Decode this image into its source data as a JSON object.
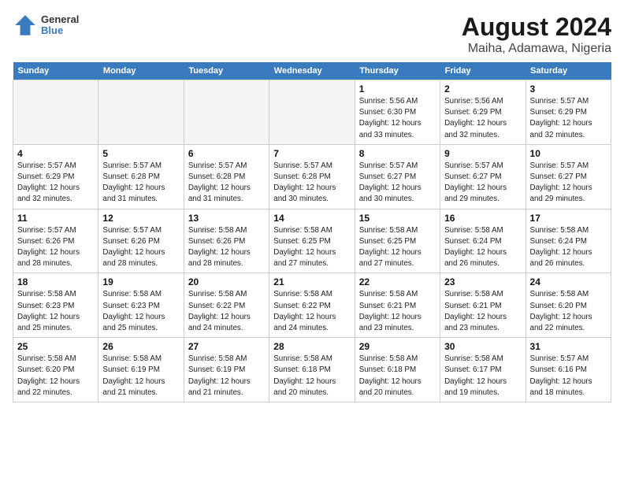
{
  "header": {
    "logo_line1": "General",
    "logo_line2": "Blue",
    "title": "August 2024",
    "subtitle": "Maiha, Adamawa, Nigeria"
  },
  "calendar": {
    "weekdays": [
      "Sunday",
      "Monday",
      "Tuesday",
      "Wednesday",
      "Thursday",
      "Friday",
      "Saturday"
    ],
    "weeks": [
      [
        {
          "day": "",
          "info": ""
        },
        {
          "day": "",
          "info": ""
        },
        {
          "day": "",
          "info": ""
        },
        {
          "day": "",
          "info": ""
        },
        {
          "day": "1",
          "info": "Sunrise: 5:56 AM\nSunset: 6:30 PM\nDaylight: 12 hours\nand 33 minutes."
        },
        {
          "day": "2",
          "info": "Sunrise: 5:56 AM\nSunset: 6:29 PM\nDaylight: 12 hours\nand 32 minutes."
        },
        {
          "day": "3",
          "info": "Sunrise: 5:57 AM\nSunset: 6:29 PM\nDaylight: 12 hours\nand 32 minutes."
        }
      ],
      [
        {
          "day": "4",
          "info": "Sunrise: 5:57 AM\nSunset: 6:29 PM\nDaylight: 12 hours\nand 32 minutes."
        },
        {
          "day": "5",
          "info": "Sunrise: 5:57 AM\nSunset: 6:28 PM\nDaylight: 12 hours\nand 31 minutes."
        },
        {
          "day": "6",
          "info": "Sunrise: 5:57 AM\nSunset: 6:28 PM\nDaylight: 12 hours\nand 31 minutes."
        },
        {
          "day": "7",
          "info": "Sunrise: 5:57 AM\nSunset: 6:28 PM\nDaylight: 12 hours\nand 30 minutes."
        },
        {
          "day": "8",
          "info": "Sunrise: 5:57 AM\nSunset: 6:27 PM\nDaylight: 12 hours\nand 30 minutes."
        },
        {
          "day": "9",
          "info": "Sunrise: 5:57 AM\nSunset: 6:27 PM\nDaylight: 12 hours\nand 29 minutes."
        },
        {
          "day": "10",
          "info": "Sunrise: 5:57 AM\nSunset: 6:27 PM\nDaylight: 12 hours\nand 29 minutes."
        }
      ],
      [
        {
          "day": "11",
          "info": "Sunrise: 5:57 AM\nSunset: 6:26 PM\nDaylight: 12 hours\nand 28 minutes."
        },
        {
          "day": "12",
          "info": "Sunrise: 5:57 AM\nSunset: 6:26 PM\nDaylight: 12 hours\nand 28 minutes."
        },
        {
          "day": "13",
          "info": "Sunrise: 5:58 AM\nSunset: 6:26 PM\nDaylight: 12 hours\nand 28 minutes."
        },
        {
          "day": "14",
          "info": "Sunrise: 5:58 AM\nSunset: 6:25 PM\nDaylight: 12 hours\nand 27 minutes."
        },
        {
          "day": "15",
          "info": "Sunrise: 5:58 AM\nSunset: 6:25 PM\nDaylight: 12 hours\nand 27 minutes."
        },
        {
          "day": "16",
          "info": "Sunrise: 5:58 AM\nSunset: 6:24 PM\nDaylight: 12 hours\nand 26 minutes."
        },
        {
          "day": "17",
          "info": "Sunrise: 5:58 AM\nSunset: 6:24 PM\nDaylight: 12 hours\nand 26 minutes."
        }
      ],
      [
        {
          "day": "18",
          "info": "Sunrise: 5:58 AM\nSunset: 6:23 PM\nDaylight: 12 hours\nand 25 minutes."
        },
        {
          "day": "19",
          "info": "Sunrise: 5:58 AM\nSunset: 6:23 PM\nDaylight: 12 hours\nand 25 minutes."
        },
        {
          "day": "20",
          "info": "Sunrise: 5:58 AM\nSunset: 6:22 PM\nDaylight: 12 hours\nand 24 minutes."
        },
        {
          "day": "21",
          "info": "Sunrise: 5:58 AM\nSunset: 6:22 PM\nDaylight: 12 hours\nand 24 minutes."
        },
        {
          "day": "22",
          "info": "Sunrise: 5:58 AM\nSunset: 6:21 PM\nDaylight: 12 hours\nand 23 minutes."
        },
        {
          "day": "23",
          "info": "Sunrise: 5:58 AM\nSunset: 6:21 PM\nDaylight: 12 hours\nand 23 minutes."
        },
        {
          "day": "24",
          "info": "Sunrise: 5:58 AM\nSunset: 6:20 PM\nDaylight: 12 hours\nand 22 minutes."
        }
      ],
      [
        {
          "day": "25",
          "info": "Sunrise: 5:58 AM\nSunset: 6:20 PM\nDaylight: 12 hours\nand 22 minutes."
        },
        {
          "day": "26",
          "info": "Sunrise: 5:58 AM\nSunset: 6:19 PM\nDaylight: 12 hours\nand 21 minutes."
        },
        {
          "day": "27",
          "info": "Sunrise: 5:58 AM\nSunset: 6:19 PM\nDaylight: 12 hours\nand 21 minutes."
        },
        {
          "day": "28",
          "info": "Sunrise: 5:58 AM\nSunset: 6:18 PM\nDaylight: 12 hours\nand 20 minutes."
        },
        {
          "day": "29",
          "info": "Sunrise: 5:58 AM\nSunset: 6:18 PM\nDaylight: 12 hours\nand 20 minutes."
        },
        {
          "day": "30",
          "info": "Sunrise: 5:58 AM\nSunset: 6:17 PM\nDaylight: 12 hours\nand 19 minutes."
        },
        {
          "day": "31",
          "info": "Sunrise: 5:57 AM\nSunset: 6:16 PM\nDaylight: 12 hours\nand 18 minutes."
        }
      ]
    ]
  }
}
